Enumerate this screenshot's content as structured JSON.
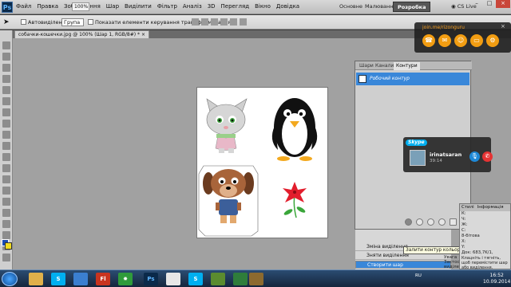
{
  "app": {
    "logo": "Ps",
    "menu": [
      "Файл",
      "Правка",
      "Зображення",
      "Шар",
      "Виділити",
      "Фільтр",
      "Аналіз",
      "3D",
      "Перегляд",
      "Вікно",
      "Довідка"
    ],
    "zoom": "100%",
    "workspaces": [
      "Основне",
      "Малювання",
      "Розробка"
    ],
    "active_workspace": "Розробка",
    "cs_live": "CS Live",
    "window_controls": [
      "–",
      "□",
      "×"
    ]
  },
  "options": {
    "auto_select_label": "Автовиділення:",
    "auto_select_value": "Група",
    "show_transform_label": "Показати елементи керування трансформуванням"
  },
  "document": {
    "tab_label": "собачки-кошечки.jpg @ 100% (Шар 1, RGB/8#) *",
    "close": "×"
  },
  "paths_panel": {
    "tabs": [
      "Шари",
      "Канали",
      "Контури"
    ],
    "active_tab": "Контури",
    "path_name": "Робочий контур",
    "tooltip": "Залити контур кольором переднього плану"
  },
  "history": {
    "rows": [
      "Зміна виділення",
      "Зняти виділення",
      "Створити шар"
    ],
    "selected": "Створити шар"
  },
  "info_panel": {
    "tabs": [
      "Стилі",
      "Інформація"
    ],
    "lines": [
      "К:",
      "Ч:",
      "Ж:",
      "C:",
      "8-бітова",
      "X:",
      "Y:",
      "Док: 683,7K/1,",
      "Клацніть і тягніть, щоб перемістити шар або виділення. Застосуйте"
    ],
    "side": [
      "Увага",
      "Застос",
      "виділе"
    ]
  },
  "skype": {
    "logo": "Skype",
    "name": "irinatsaran",
    "time": "39:14"
  },
  "joinme": {
    "title": "join.me/rizonguru",
    "close": "×"
  },
  "taskbar": {
    "tray_lang": "RU",
    "time": "16:52",
    "date": "10.09.2014"
  },
  "colors": {
    "foreground": "#1a4bb3",
    "background": "#f1dc1f",
    "accent": "#3987d9",
    "joinme": "#f29d12"
  }
}
